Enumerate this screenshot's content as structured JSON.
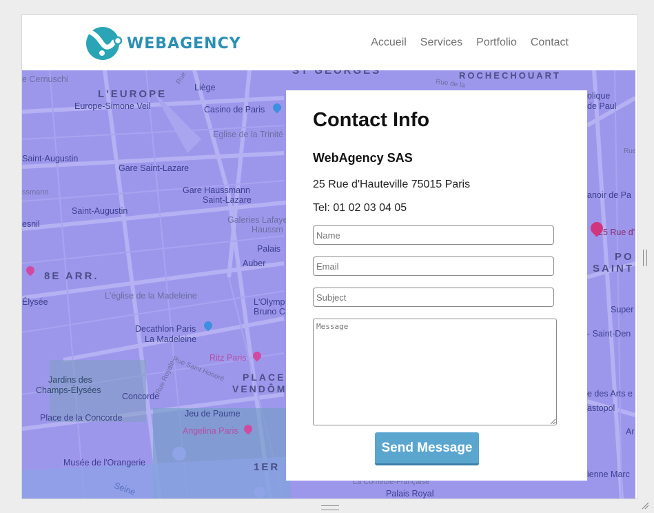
{
  "brand": {
    "name": "WEBAGENCY",
    "color": "#2a8fb5",
    "logo_icon": "webagency-logo-icon"
  },
  "nav": {
    "items": [
      "Accueil",
      "Services",
      "Portfolio",
      "Contact"
    ]
  },
  "map": {
    "overlay_color": "#9d97ec",
    "labels": {
      "cernuschi": "e Cernuschi",
      "leurope": "L'EUROPE",
      "europe_simone_veil": "Europe-Simone Veil",
      "liege": "Liège",
      "casino_de_paris": "Casino de Paris",
      "st_georges": "ST GEORGES",
      "rochechouart": "ROCHECHOUART",
      "eglise_trinite": "Eglise de la Trinité",
      "saint_augustin": "Saint-Augustin",
      "gare_saint_lazare": "Gare Saint-Lazare",
      "gare_haussmann": "Gare Haussmann",
      "saint_lazare": "Saint-Lazare",
      "smann": "ssmann",
      "saint_augustin_metro": "Saint-Augustin",
      "galeries_lafayette": "Galeries Lafaye",
      "haussm": "Haussm",
      "esnil": "esnil",
      "palais": "Palais",
      "auber": "Auber",
      "8e_arr": "8E ARR.",
      "elysee": "Élysée",
      "eglise_madeleine": "L'église de la Madeleine",
      "lolympia": "L'Olymp",
      "bruno": "Bruno C",
      "decathlon": "Decathlon Paris",
      "la_madeleine": "La Madeleine",
      "ritz_paris": "Ritz Paris",
      "rue_royale": "Rue Royale",
      "rue_saint_honore": "Rue Saint Honoré",
      "place_vendome_1": "PLACE",
      "place_vendome_2": "VENDÔM",
      "jardins": "Jardins des",
      "champs": "Champs-Élysées",
      "concorde": "Concorde",
      "place_concorde": "Place de la Concorde",
      "jeu_de_paume": "Jeu de Paume",
      "angelina": "Angelina Paris",
      "musee_orangerie": "Musée de l'Orangerie",
      "1er": "1ER",
      "comedie_francaise": "La Comédie-Française",
      "palais_royal": "Palais Royal",
      "seine": "Seine",
      "rue_de_la": "Rue de la",
      "rue_du_rocher": "Rue du Rocher",
      "olique": "olique",
      "de_paul": "de Paul",
      "rue_right": "Rue",
      "anoir": "anoir de Pa",
      "address_pin": "25 Rue d'",
      "po": "PO",
      "saint_r": "SAINT",
      "super": "Super",
      "saint_den": "- Saint-Den",
      "des_arts": "e des Arts e",
      "astopol": "astopol",
      "ar": "Ar",
      "enne_marc": "ienne Marc",
      "rue_de_l": "Rue de l'",
      "rue_st_lazare": "Rue"
    }
  },
  "contact": {
    "title": "Contact Info",
    "company": "WebAgency SAS",
    "address": "25 Rue d'Hauteville 75015 Paris",
    "tel": "Tel: 01 02 03 04 05",
    "name_placeholder": "Name",
    "email_placeholder": "Email",
    "subject_placeholder": "Subject",
    "message_placeholder": "Message",
    "send_label": "Send Message",
    "button_color": "#5ba6cf"
  }
}
